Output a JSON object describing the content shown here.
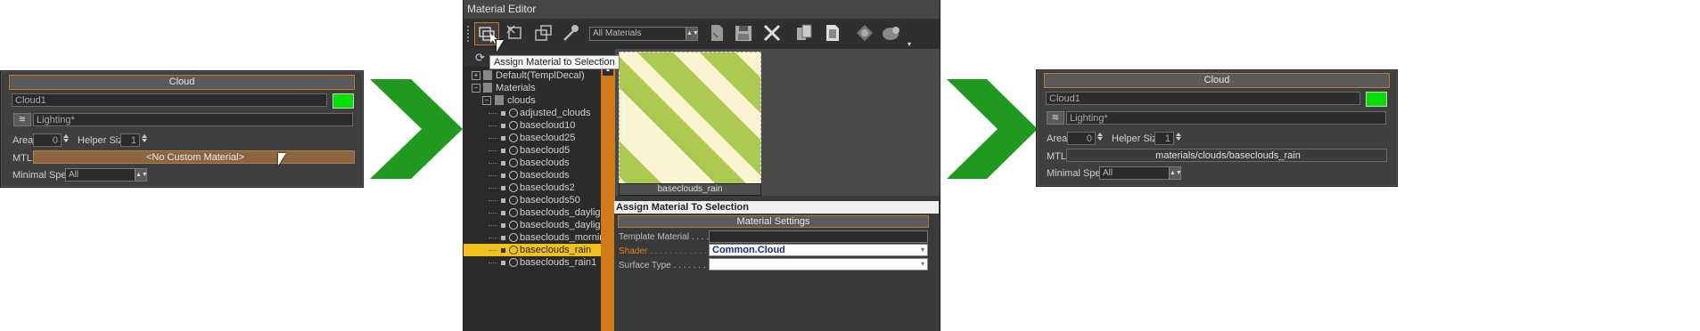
{
  "left_panel": {
    "title": "Cloud",
    "name_value": "Cloud1",
    "layer_value": "Lighting*",
    "area_label": "Area:",
    "area_value": "0",
    "helper_label": "Helper Size:",
    "helper_value": "1",
    "mtl_label": "MTL",
    "mtl_value": "<No Custom Material>",
    "minspec_label": "Minimal Spec:",
    "minspec_value": "All"
  },
  "right_panel": {
    "title": "Cloud",
    "name_value": "Cloud1",
    "layer_value": "Lighting*",
    "area_label": "Area:",
    "area_value": "0",
    "helper_label": "Helper Size:",
    "helper_value": "1",
    "mtl_label": "MTL",
    "mtl_value": "materials/clouds/baseclouds_rain",
    "minspec_label": "Minimal Spec:",
    "minspec_value": "All"
  },
  "material_editor": {
    "title": "Material Editor",
    "filter_value": "All Materials",
    "tooltip": "Assign Material to Selection",
    "tree": {
      "root1": "Default(TemplDecal)",
      "root2": "Materials",
      "folder": "clouds",
      "items": [
        "adjusted_clouds",
        "basecloud10",
        "basecloud25",
        "basecloud5",
        "baseclouds",
        "baseclouds",
        "baseclouds2",
        "baseclouds50",
        "baseclouds_daylight",
        "baseclouds_daylight",
        "baseclouds_morning",
        "baseclouds_rain",
        "baseclouds_rain1"
      ],
      "selected_index": 11
    },
    "preview_caption": "baseclouds_rain",
    "assign_title": "Assign Material To Selection",
    "settings_header": "Material Settings",
    "template_label": "Template Material . . . . .",
    "template_value": "",
    "shader_label": "Shader . . . . . . . . . . . . .",
    "shader_value": "Common.Cloud",
    "surface_label": "Surface Type . . . . . . . .",
    "surface_value": ""
  },
  "colors": {
    "accent": "#d07a1a",
    "selection": "#f2c21b",
    "arrow": "#1f9a1f",
    "swatch": "#00e000"
  }
}
